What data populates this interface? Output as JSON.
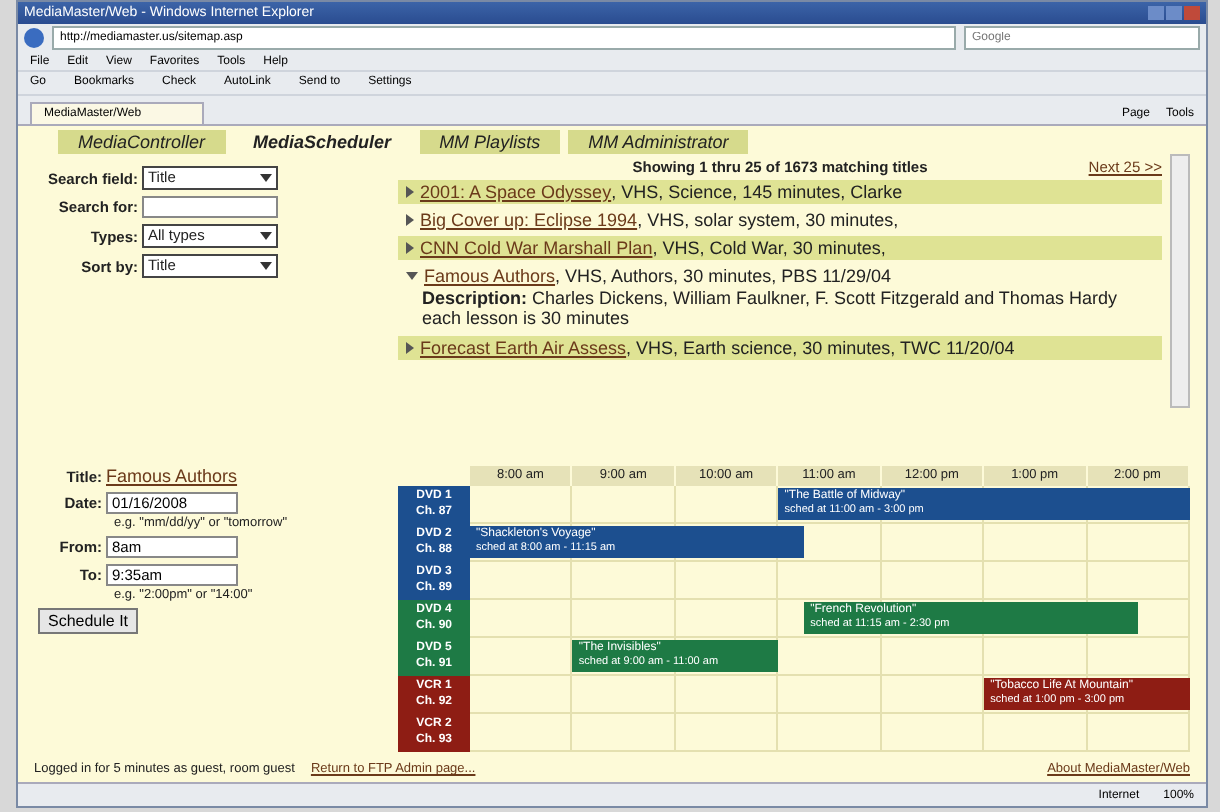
{
  "window": {
    "title": "MediaMaster/Web - Windows Internet Explorer"
  },
  "address_bar": {
    "url": "http://mediamaster.us/sitemap.asp",
    "search_placeholder": "Google"
  },
  "menu": [
    "File",
    "Edit",
    "View",
    "Favorites",
    "Tools",
    "Help"
  ],
  "toolbar": [
    "Go",
    "Bookmarks",
    "Check",
    "AutoLink",
    "Send to",
    "Settings"
  ],
  "browser_tab": {
    "title": "MediaMaster/Web"
  },
  "command_bar": [
    "Page",
    "Tools"
  ],
  "app_tabs": [
    {
      "label": "MediaController",
      "selected": false
    },
    {
      "label": "MediaScheduler",
      "selected": true
    },
    {
      "label": "MM Playlists",
      "selected": false
    },
    {
      "label": "MM Administrator",
      "selected": false
    }
  ],
  "search_form": [
    {
      "kind": "select",
      "label": "Search field:",
      "value": "Title"
    },
    {
      "kind": "input",
      "label": "Search for:"
    },
    {
      "kind": "select",
      "label": "Types:",
      "value": "All types"
    },
    {
      "kind": "select",
      "label": "Sort by:",
      "value": "Title"
    }
  ],
  "results": {
    "summary": "Showing 1 thru 25 of 1673 matching titles",
    "next": "Next 25 >>",
    "items": [
      {
        "title": "2001: A Space Odyssey",
        "details": ", VHS, Science, 145 minutes, Clarke",
        "expanded": false
      },
      {
        "title": "Big Cover up: Eclipse 1994",
        "details": ", VHS, solar system, 30 minutes,",
        "expanded": false
      },
      {
        "title": "CNN Cold War Marshall Plan",
        "details": ", VHS, Cold War, 30 minutes,",
        "expanded": false
      },
      {
        "title": "Famous Authors",
        "details": ", VHS, Authors, 30 minutes, PBS 11/29/04",
        "expanded": true,
        "description_label": "Description:",
        "description": "Charles Dickens, William Faulkner, F. Scott Fitzgerald and Thomas Hardy each lesson is 30 minutes"
      },
      {
        "title": "Forecast Earth Air Assess",
        "details": ", VHS, Earth science, 30 minutes, TWC 11/20/04",
        "expanded": false
      }
    ]
  },
  "schedule_form": {
    "title_label": "Title:",
    "title": "Famous Authors",
    "date_label": "Date:",
    "date": "01/16/2008",
    "date_hint": "e.g. \"mm/dd/yy\" or \"tomorrow\"",
    "from_label": "From:",
    "from": "8am",
    "to_label": "To:",
    "to": "9:35am",
    "time_hint": "e.g. \"2:00pm\" or \"14:00\"",
    "button": "Schedule It"
  },
  "schedule": {
    "times": [
      "8:00 am",
      "9:00 am",
      "10:00 am",
      "11:00 am",
      "12:00 pm",
      "1:00 pm",
      "2:00 pm"
    ],
    "channels": [
      {
        "name": "DVD 1",
        "channel": "Ch. 87",
        "color": "#1c4f8f",
        "events": [
          {
            "title": "\"The Battle of Midway\"",
            "time": "sched at 11:00 am - 3:00 pm"
          }
        ]
      },
      {
        "name": "DVD 2",
        "channel": "Ch. 88",
        "color": "#1c4f8f",
        "events": [
          {
            "title": "\"Shackleton's Voyage\"",
            "time": "sched at 8:00 am - 11:15 am"
          }
        ]
      },
      {
        "name": "DVD 3",
        "channel": "Ch. 89",
        "color": "#1c4f8f"
      },
      {
        "name": "DVD 4",
        "channel": "Ch. 90",
        "color": "#1e7a45",
        "events": [
          {
            "title": "\"French Revolution\"",
            "time": "sched at 11:15 am - 2:30 pm"
          }
        ]
      },
      {
        "name": "DVD 5",
        "channel": "Ch. 91",
        "color": "#1e7a45",
        "events": [
          {
            "title": "\"The Invisibles\"",
            "time": "sched at 9:00 am - 11:00 am"
          }
        ]
      },
      {
        "name": "VCR 1",
        "channel": "Ch. 92",
        "color": "#8e1d14",
        "events": [
          {
            "title": "\"Tobacco Life At Mountain\"",
            "time": "sched at 1:00 pm - 3:00 pm"
          }
        ]
      },
      {
        "name": "VCR 2",
        "channel": "Ch. 93",
        "color": "#8e1d14"
      }
    ]
  },
  "footer": {
    "status": "Logged in for 5 minutes as guest, room guest",
    "return_link": "Return to FTP Admin page...",
    "about_link": "About MediaMaster/Web"
  },
  "status_bar": {
    "zone": "Internet",
    "zoom": "100%"
  }
}
